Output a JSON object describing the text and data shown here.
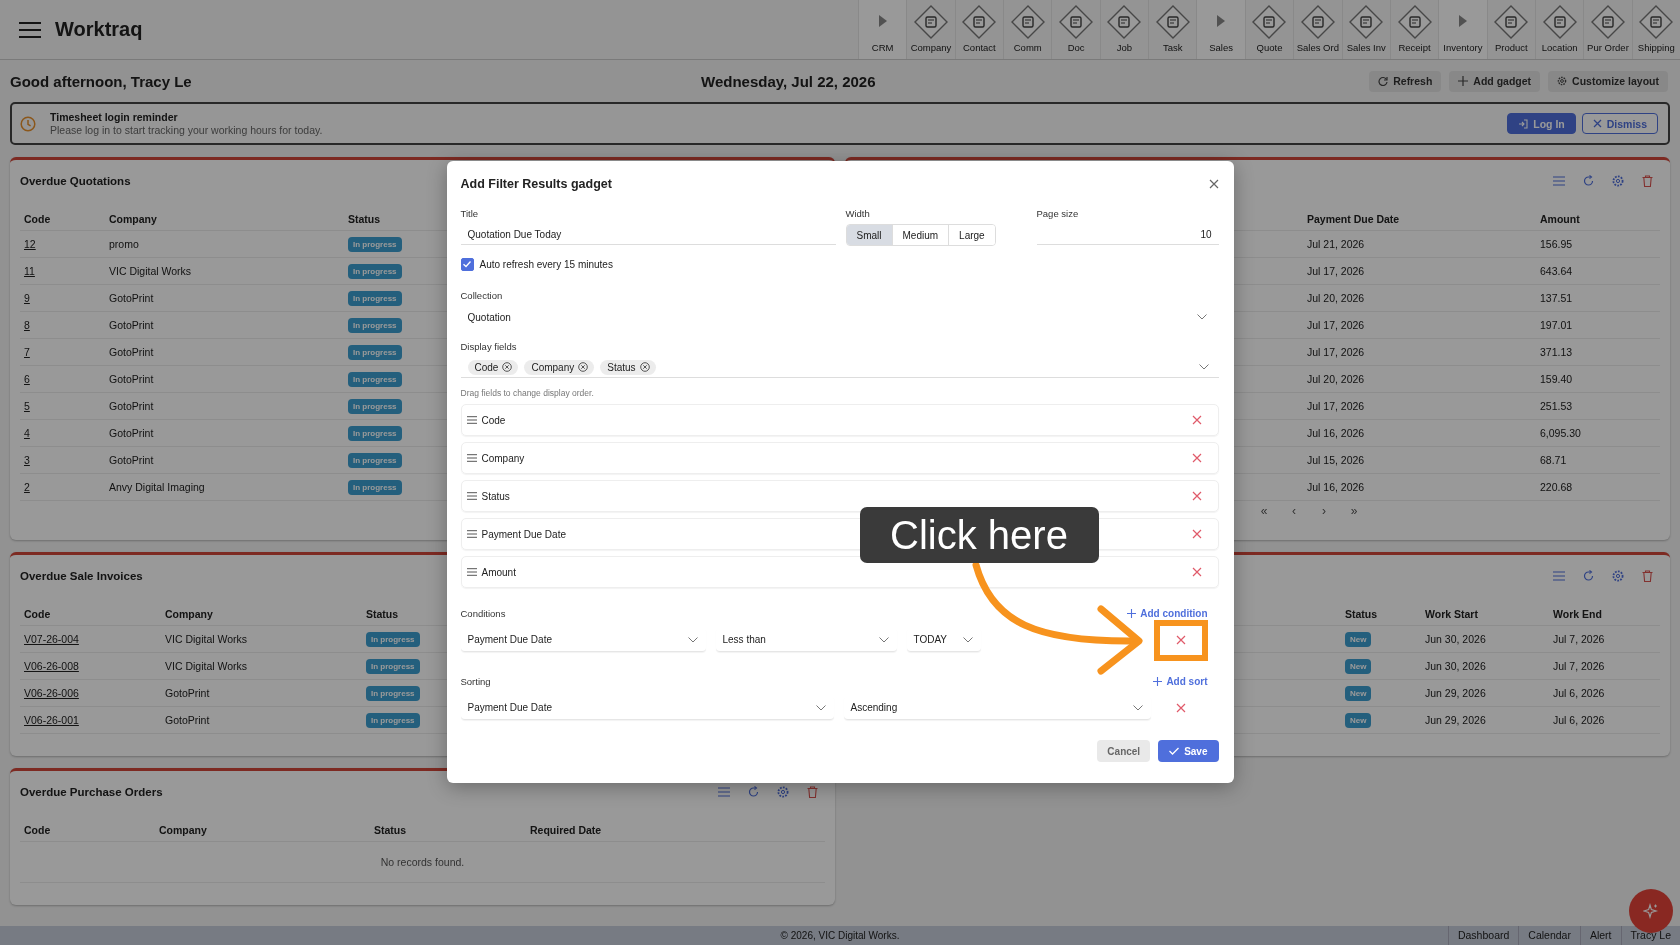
{
  "app": {
    "title": "Worktraq"
  },
  "toolbar": [
    {
      "label": "CRM",
      "kind": "group"
    },
    {
      "label": "Company",
      "kind": "module"
    },
    {
      "label": "Contact",
      "kind": "module"
    },
    {
      "label": "Comm",
      "kind": "module"
    },
    {
      "label": "Doc",
      "kind": "module"
    },
    {
      "label": "Job",
      "kind": "module"
    },
    {
      "label": "Task",
      "kind": "module"
    },
    {
      "label": "Sales",
      "kind": "group"
    },
    {
      "label": "Quote",
      "kind": "module"
    },
    {
      "label": "Sales Ord",
      "kind": "module"
    },
    {
      "label": "Sales Inv",
      "kind": "module"
    },
    {
      "label": "Receipt",
      "kind": "module"
    },
    {
      "label": "Inventory",
      "kind": "group"
    },
    {
      "label": "Product",
      "kind": "module"
    },
    {
      "label": "Location",
      "kind": "module"
    },
    {
      "label": "Pur Order",
      "kind": "module"
    },
    {
      "label": "Shipping",
      "kind": "module"
    }
  ],
  "greeting": "Good afternoon, Tracy Le",
  "date": "Wednesday, Jul 22, 2026",
  "header_actions": [
    "Refresh",
    "Add gadget",
    "Customize layout"
  ],
  "reminder": {
    "title": "Timesheet login reminder",
    "message": "Please log in to start tracking your working hours for today.",
    "actions": [
      {
        "label": "Log In",
        "kind": "primary"
      },
      {
        "label": "Dismiss",
        "kind": "outline"
      }
    ]
  },
  "left_panels": [
    {
      "title": "Overdue Quotations",
      "columns": [
        {
          "label": "Code",
          "kind": "link"
        },
        {
          "label": "Company",
          "kind": "text"
        },
        {
          "label": "Status",
          "kind": "badge"
        }
      ],
      "rows": [
        [
          "12",
          "promo",
          "In progress"
        ],
        [
          "11",
          "VIC Digital Works",
          "In progress"
        ],
        [
          "9",
          "GotoPrint",
          "In progress"
        ],
        [
          "8",
          "GotoPrint",
          "In progress"
        ],
        [
          "7",
          "GotoPrint",
          "In progress"
        ],
        [
          "6",
          "GotoPrint",
          "In progress"
        ],
        [
          "5",
          "GotoPrint",
          "In progress"
        ],
        [
          "4",
          "GotoPrint",
          "In progress"
        ],
        [
          "3",
          "GotoPrint",
          "In progress"
        ],
        [
          "2",
          "Anvy Digital Imaging",
          "In progress"
        ]
      ]
    },
    {
      "title": "Overdue Sale Invoices",
      "columns": [
        {
          "label": "Code",
          "kind": "link"
        },
        {
          "label": "Company",
          "kind": "text"
        },
        {
          "label": "Status",
          "kind": "badge"
        }
      ],
      "rows": [
        [
          "V07-26-004",
          "VIC Digital Works",
          "In progress"
        ],
        [
          "V06-26-008",
          "VIC Digital Works",
          "In progress"
        ],
        [
          "V06-26-006",
          "GotoPrint",
          "In progress"
        ],
        [
          "V06-26-001",
          "GotoPrint",
          "In progress"
        ]
      ]
    },
    {
      "title": "Overdue Purchase Orders",
      "show_tools": true,
      "columns": [
        {
          "label": "Code"
        },
        {
          "label": "Company"
        },
        {
          "label": "Status"
        },
        {
          "label": "Required Date"
        }
      ],
      "empty_message": "No records found."
    }
  ],
  "right_panels": [
    {
      "show_tools": true,
      "columns": [
        {
          "label": "Payment Due Date",
          "kind": "text"
        },
        {
          "label": "Amount",
          "kind": "text"
        }
      ],
      "rows": [
        [
          "Jul 21, 2026",
          "156.95"
        ],
        [
          "Jul 17, 2026",
          "643.64"
        ],
        [
          "Jul 20, 2026",
          "137.51"
        ],
        [
          "Jul 17, 2026",
          "197.01"
        ],
        [
          "Jul 17, 2026",
          "371.13"
        ],
        [
          "Jul 20, 2026",
          "159.40"
        ],
        [
          "Jul 17, 2026",
          "251.53"
        ],
        [
          "Jul 16, 2026",
          "6,095.30"
        ],
        [
          "Jul 15, 2026",
          "68.71"
        ],
        [
          "Jul 16, 2026",
          "220.68"
        ]
      ],
      "pager": [
        "«",
        "‹",
        "›",
        "»"
      ]
    },
    {
      "show_tools": true,
      "columns": [
        {
          "label": "Status",
          "kind": "badge"
        },
        {
          "label": "Work Start",
          "kind": "text"
        },
        {
          "label": "Work End",
          "kind": "text"
        }
      ],
      "rows": [
        [
          "New",
          "Jun 30, 2026",
          "Jul 7, 2026"
        ],
        [
          "New",
          "Jun 30, 2026",
          "Jul 7, 2026"
        ],
        [
          "New",
          "Jun 29, 2026",
          "Jul 6, 2026"
        ],
        [
          "New",
          "Jun 29, 2026",
          "Jul 6, 2026"
        ]
      ]
    }
  ],
  "footer": {
    "copyright": "© 2026, VIC Digital Works.",
    "links": [
      "Dashboard",
      "Calendar",
      "Alert",
      "Tracy Le"
    ]
  },
  "modal": {
    "title": "Add Filter Results gadget",
    "title_field": {
      "label": "Title",
      "value": "Quotation Due Today"
    },
    "width_field": {
      "label": "Width",
      "options": [
        {
          "label": "Small",
          "selected": true
        },
        {
          "label": "Medium",
          "selected": false
        },
        {
          "label": "Large",
          "selected": false
        }
      ]
    },
    "page_size_field": {
      "label": "Page size",
      "value": "10"
    },
    "auto_refresh": {
      "label": "Auto refresh every 15 minutes",
      "checked": true
    },
    "collection": {
      "label": "Collection",
      "value": "Quotation"
    },
    "display_fields": {
      "label": "Display fields",
      "chips": [
        "Code",
        "Company",
        "Status"
      ],
      "hint": "Drag fields to change display order.",
      "items": [
        "Code",
        "Company",
        "Status",
        "Payment Due Date",
        "Amount"
      ]
    },
    "conditions": {
      "label": "Conditions",
      "add_label": "Add condition",
      "rows": [
        {
          "field": "Payment Due Date",
          "operator": "Less than",
          "value": "TODAY"
        }
      ]
    },
    "sorting": {
      "label": "Sorting",
      "add_label": "Add sort",
      "rows": [
        {
          "field": "Payment Due Date",
          "direction": "Ascending"
        }
      ]
    },
    "buttons": [
      {
        "label": "Cancel",
        "kind": "secondary"
      },
      {
        "label": "Save",
        "kind": "primary"
      }
    ]
  },
  "annotation": {
    "text": "Click here"
  }
}
